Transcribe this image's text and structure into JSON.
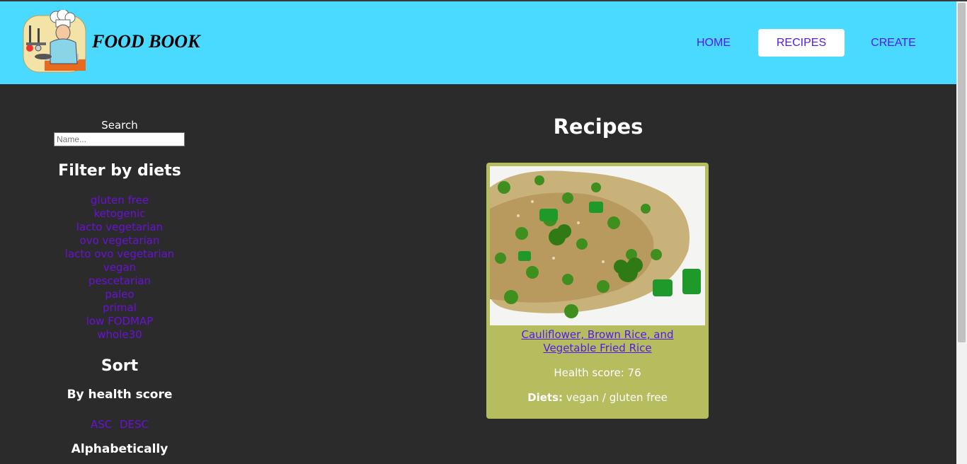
{
  "header": {
    "brand": "FOOD BOOK",
    "logo_icon": "chef-icon",
    "nav": [
      {
        "label": "HOME",
        "active": false
      },
      {
        "label": "RECIPES",
        "active": true
      },
      {
        "label": "CREATE",
        "active": false
      }
    ]
  },
  "sidebar": {
    "search_label": "Search",
    "search_placeholder": "Name...",
    "filter_title": "Filter by diets",
    "diets": [
      "gluten free",
      "ketogenic",
      "lacto vegetarian",
      "ovo vegetarian",
      "lacto ovo vegetarian",
      "vegan",
      "pescetarian",
      "paleo",
      "primal",
      "low FODMAP",
      "whole30"
    ],
    "sort_title": "Sort",
    "health_title": "By health score",
    "asc": "ASC",
    "desc": "DESC",
    "alpha_title": "Alphabetically"
  },
  "main": {
    "title": "Recipes",
    "recipes": [
      {
        "title": "Cauliflower, Brown Rice, and Vegetable Fried Rice",
        "health": "Health score: 76",
        "diets_label": "Diets:",
        "diets": "vegan / gluten free"
      }
    ]
  },
  "colors": {
    "header_bg": "#4bdaff",
    "page_bg": "#2b2b2b",
    "card_bg": "#b5bd5f",
    "link": "#6b11d6"
  }
}
